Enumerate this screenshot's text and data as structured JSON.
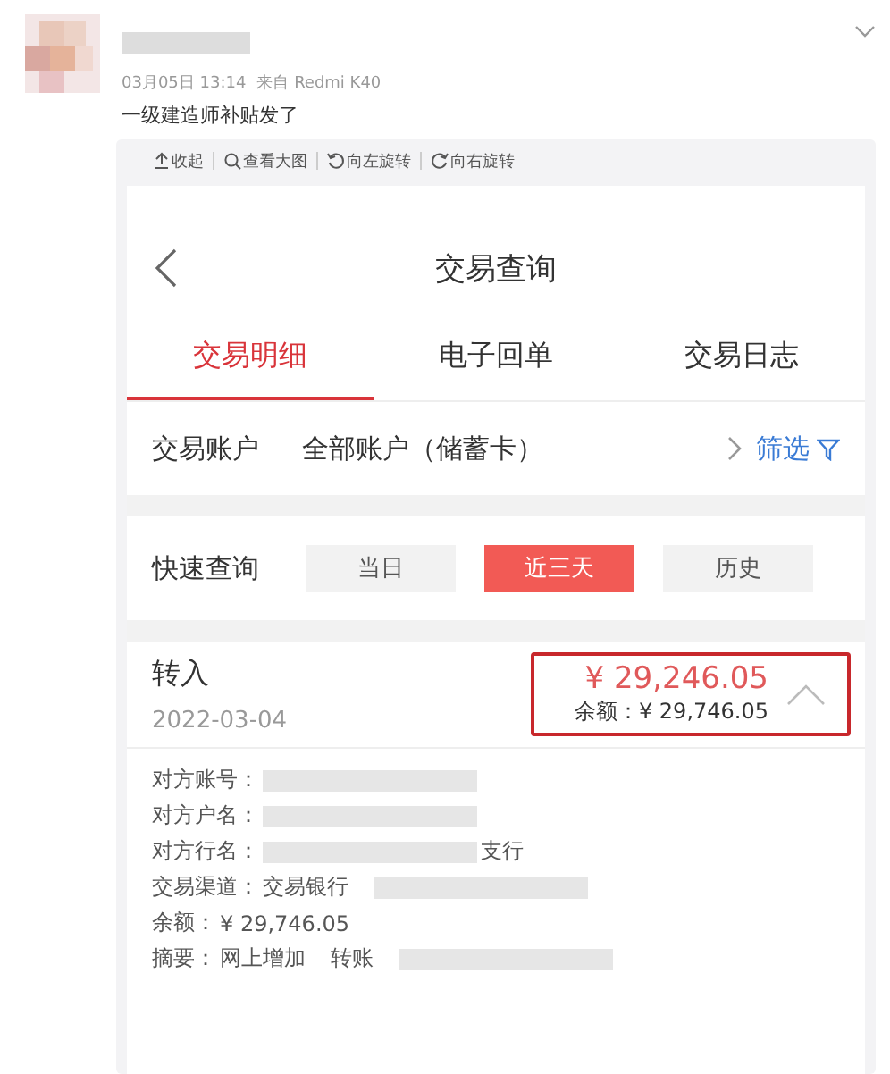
{
  "post": {
    "timestamp": "03月05日 13:14",
    "source": "来自 Redmi K40",
    "text": "一级建造师补贴发了"
  },
  "image_toolbar": [
    {
      "kind": "collapse",
      "label": "收起"
    },
    {
      "kind": "zoom",
      "label": "查看大图"
    },
    {
      "kind": "rotate_left",
      "label": "向左旋转"
    },
    {
      "kind": "rotate_right",
      "label": "向右旋转"
    }
  ],
  "app": {
    "title": "交易查询",
    "tabs": [
      {
        "label": "交易明细",
        "selected": true
      },
      {
        "label": "电子回单",
        "selected": false
      },
      {
        "label": "交易日志",
        "selected": false
      }
    ],
    "account": {
      "label": "交易账户",
      "value": "全部账户（储蓄卡）",
      "filter": "筛选"
    },
    "quick_query": {
      "label": "快速查询",
      "options": [
        {
          "label": "当日",
          "selected": false
        },
        {
          "label": "近三天",
          "selected": true
        },
        {
          "label": "历史",
          "selected": false
        }
      ]
    },
    "transaction": {
      "type": "转入",
      "date": "2022-03-04",
      "amount": "¥ 29,246.05",
      "balance": "余额：¥ 29,746.05",
      "highlighted": true,
      "expanded": true,
      "details": [
        {
          "label": "对方账号：",
          "redacted": true
        },
        {
          "label": "对方户名：",
          "redacted": true
        },
        {
          "label": "对方行名：",
          "redacted": true,
          "suffix": "支行"
        },
        {
          "label": "交易渠道：",
          "values": [
            "交易银行"
          ],
          "redacted": true
        },
        {
          "label": "余额：",
          "values": [
            "¥ 29,746.05"
          ],
          "redacted": false
        },
        {
          "label": "摘要：",
          "values": [
            "网上增加",
            "转账"
          ],
          "redacted": true
        }
      ]
    }
  }
}
